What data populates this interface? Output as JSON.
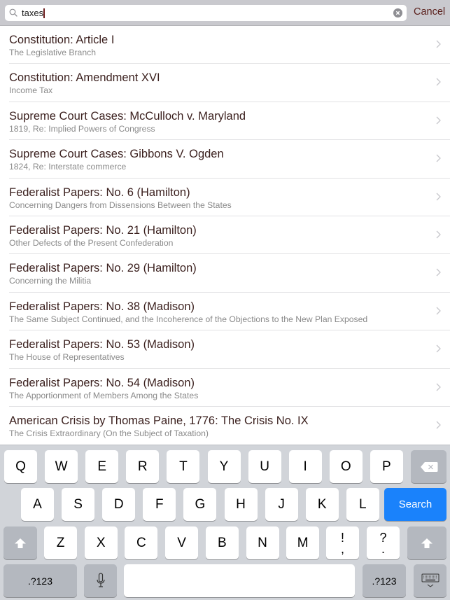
{
  "search": {
    "query": "taxes",
    "cancel_label": "Cancel"
  },
  "results": [
    {
      "title": "Constitution: Article I",
      "subtitle": "The Legislative Branch"
    },
    {
      "title": "Constitution: Amendment XVI",
      "subtitle": "Income Tax"
    },
    {
      "title": "Supreme Court Cases: McCulloch v. Maryland",
      "subtitle": "1819, Re: Implied Powers of Congress"
    },
    {
      "title": "Supreme Court Cases: Gibbons V. Ogden",
      "subtitle": "1824, Re: Interstate commerce"
    },
    {
      "title": "Federalist Papers: No. 6 (Hamilton)",
      "subtitle": "Concerning Dangers from Dissensions Between the States"
    },
    {
      "title": "Federalist Papers: No. 21 (Hamilton)",
      "subtitle": "Other Defects of the Present Confederation"
    },
    {
      "title": "Federalist Papers: No. 29 (Hamilton)",
      "subtitle": "Concerning the Militia"
    },
    {
      "title": "Federalist Papers: No. 38 (Madison)",
      "subtitle": "The Same Subject Continued, and the Incoherence of the Objections to the New Plan Exposed"
    },
    {
      "title": "Federalist Papers: No. 53 (Madison)",
      "subtitle": "The House of Representatives"
    },
    {
      "title": "Federalist Papers: No. 54 (Madison)",
      "subtitle": "The Apportionment of Members Among the States"
    },
    {
      "title": "American Crisis by Thomas Paine, 1776: The Crisis No. IX",
      "subtitle": "The Crisis Extraordinary (On the Subject of Taxation)"
    }
  ],
  "keyboard": {
    "row1": [
      "Q",
      "W",
      "E",
      "R",
      "T",
      "Y",
      "U",
      "I",
      "O",
      "P"
    ],
    "row2": [
      "A",
      "S",
      "D",
      "F",
      "G",
      "H",
      "J",
      "K",
      "L"
    ],
    "row3": [
      "Z",
      "X",
      "C",
      "V",
      "B",
      "N",
      "M"
    ],
    "punct1_top": "!",
    "punct1_bottom": ",",
    "punct2_top": "?",
    "punct2_bottom": ".",
    "search_label": "Search",
    "numbers_label": ".?123",
    "accent_color": "#1a82fb"
  },
  "colors": {
    "title_text": "#3a1f1d",
    "subtitle_text": "#8a8a8a",
    "cancel_text": "#5a1f1b"
  }
}
